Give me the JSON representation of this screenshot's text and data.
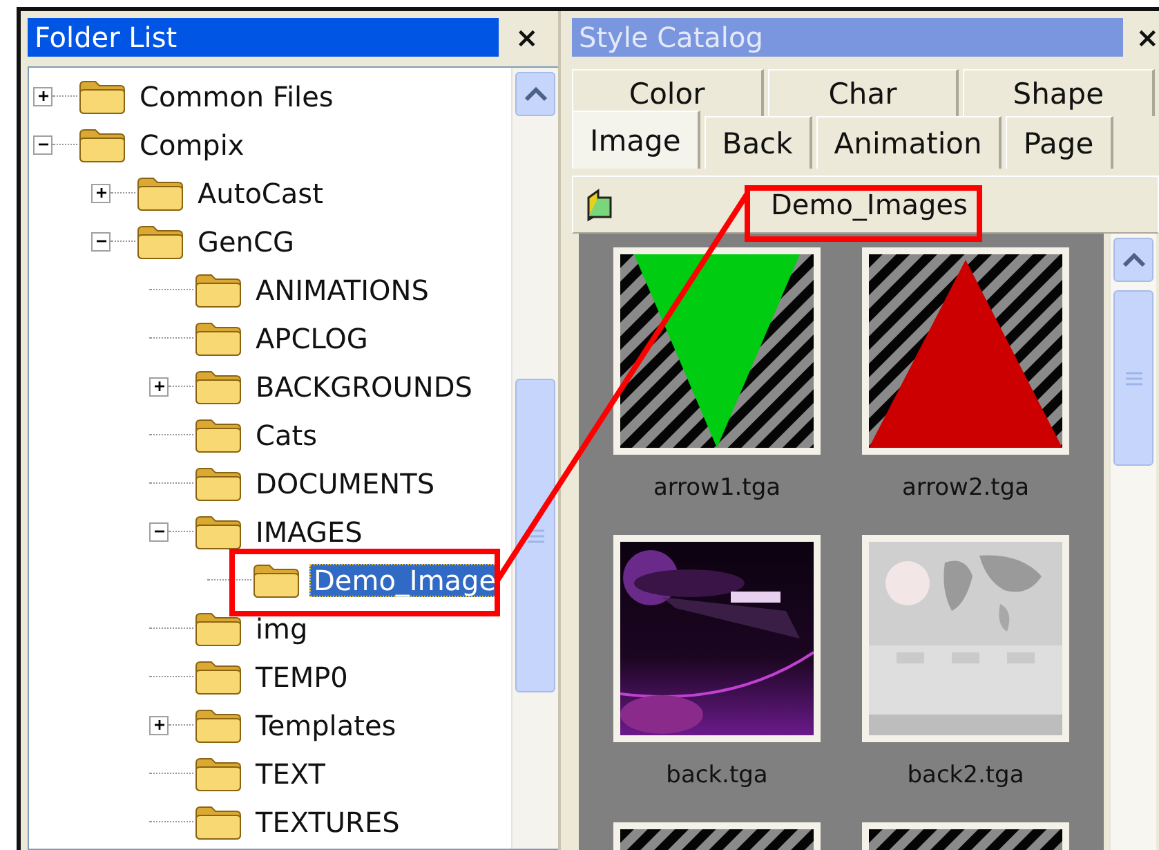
{
  "folder_list": {
    "title": "Folder List",
    "close": "×",
    "tree": [
      {
        "label": "Common Files",
        "expanded": false,
        "selected": false
      },
      {
        "label": "Compix",
        "expanded": true,
        "selected": false,
        "children": [
          {
            "label": "AutoCast",
            "expanded": false,
            "selected": false
          },
          {
            "label": "GenCG",
            "expanded": true,
            "selected": false,
            "children": [
              {
                "label": "ANIMATIONS",
                "selected": false
              },
              {
                "label": "APCLOG",
                "selected": false
              },
              {
                "label": "BACKGROUNDS",
                "expanded": false,
                "selected": false
              },
              {
                "label": "Cats",
                "selected": false
              },
              {
                "label": "DOCUMENTS",
                "selected": false
              },
              {
                "label": "IMAGES",
                "expanded": true,
                "selected": false,
                "children": [
                  {
                    "label": "Demo_Image",
                    "selected": true
                  }
                ]
              },
              {
                "label": "img",
                "selected": false
              },
              {
                "label": "TEMP0",
                "selected": false
              },
              {
                "label": "Templates",
                "expanded": false,
                "selected": false
              },
              {
                "label": "TEXT",
                "selected": false
              },
              {
                "label": "TEXTURES",
                "selected": false
              }
            ]
          }
        ]
      }
    ]
  },
  "style_catalog": {
    "title": "Style Catalog",
    "close": "×",
    "tab_rows": [
      {
        "tabs": [
          {
            "label": "Color",
            "selected": false
          },
          {
            "label": "Char",
            "selected": false
          },
          {
            "label": "Shape",
            "selected": false
          }
        ]
      },
      {
        "tabs": [
          {
            "label": "Image",
            "selected": true
          },
          {
            "label": "Back",
            "selected": false
          },
          {
            "label": "Animation",
            "selected": false
          },
          {
            "label": "Page",
            "selected": false
          }
        ]
      }
    ],
    "path": "Demo_Images",
    "items": [
      {
        "label": "arrow1.tga",
        "kind": "down-triangle",
        "color": "#00cc11"
      },
      {
        "label": "arrow2.tga",
        "kind": "up-triangle",
        "color": "#cc0000"
      },
      {
        "label": "back.tga",
        "kind": "dark-photo"
      },
      {
        "label": "back2.tga",
        "kind": "light-photo"
      },
      {
        "kind": "hatched"
      },
      {
        "kind": "hatched"
      }
    ]
  }
}
